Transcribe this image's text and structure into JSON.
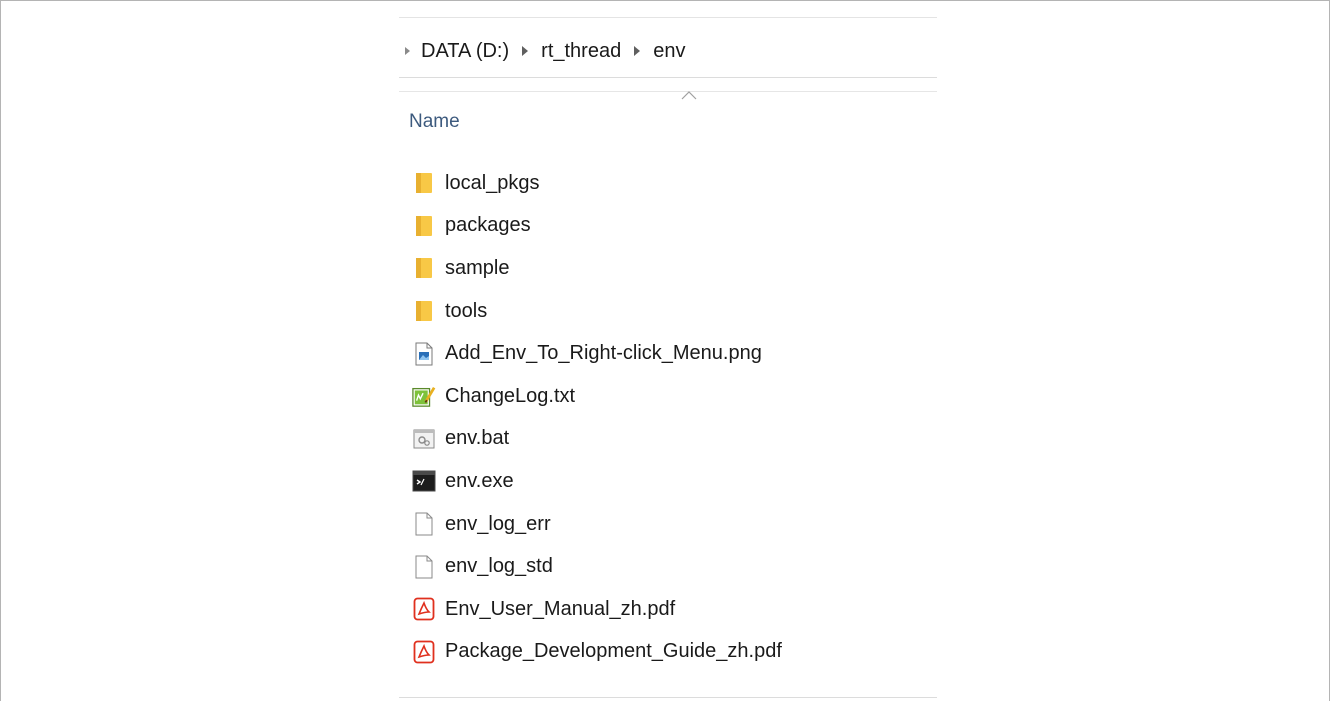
{
  "breadcrumb": {
    "items": [
      {
        "label": "DATA (D:)"
      },
      {
        "label": "rt_thread"
      },
      {
        "label": "env"
      }
    ]
  },
  "columns": {
    "name": "Name",
    "sort": "ascending"
  },
  "files": [
    {
      "name": "local_pkgs",
      "icon": "folder-icon"
    },
    {
      "name": "packages",
      "icon": "folder-icon"
    },
    {
      "name": "sample",
      "icon": "folder-icon"
    },
    {
      "name": "tools",
      "icon": "folder-icon"
    },
    {
      "name": "Add_Env_To_Right-click_Menu.png",
      "icon": "image-file-icon"
    },
    {
      "name": "ChangeLog.txt",
      "icon": "text-file-icon"
    },
    {
      "name": "env.bat",
      "icon": "batch-file-icon"
    },
    {
      "name": "env.exe",
      "icon": "console-app-icon"
    },
    {
      "name": "env_log_err",
      "icon": "blank-file-icon"
    },
    {
      "name": "env_log_std",
      "icon": "blank-file-icon"
    },
    {
      "name": "Env_User_Manual_zh.pdf",
      "icon": "pdf-file-icon"
    },
    {
      "name": "Package_Development_Guide_zh.pdf",
      "icon": "pdf-file-icon"
    }
  ],
  "colors": {
    "folder": "#f8c846",
    "header_text": "#3d5a7e",
    "pdf": "#e0301e"
  }
}
